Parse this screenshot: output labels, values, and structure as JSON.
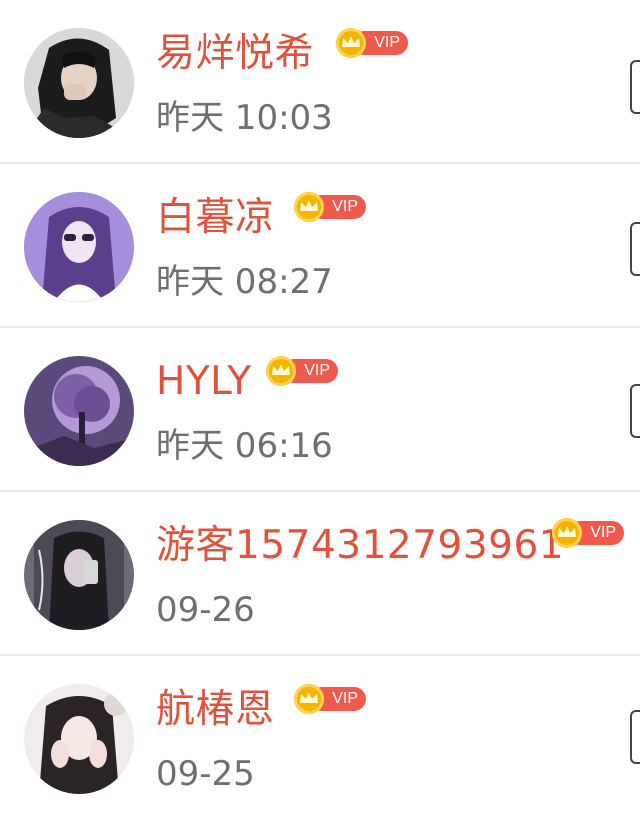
{
  "contacts": [
    {
      "name": "易烊悦希",
      "time": "昨天 10:03",
      "vip_label": "VIP",
      "avatar": "girl-hand-face-avatar"
    },
    {
      "name": "白暮凉",
      "time": "昨天 08:27",
      "vip_label": "VIP",
      "avatar": "girl-sunglasses-avatar"
    },
    {
      "name": "HYLY",
      "time": "昨天 06:16",
      "vip_label": "VIP",
      "avatar": "purple-tree-avatar"
    },
    {
      "name": "游客1574312793961",
      "time": "09-26",
      "vip_label": "VIP",
      "avatar": "mirror-selfie-avatar"
    },
    {
      "name": "航椿恩",
      "time": "09-25",
      "vip_label": "VIP",
      "avatar": "girl-hands-cheeks-avatar"
    }
  ],
  "colors": {
    "name": "#e2523a",
    "time": "#6f6f6f",
    "vip_pill": "#ef5a4d",
    "vip_coin": "#f4b400",
    "divider": "#e8e8e8"
  }
}
